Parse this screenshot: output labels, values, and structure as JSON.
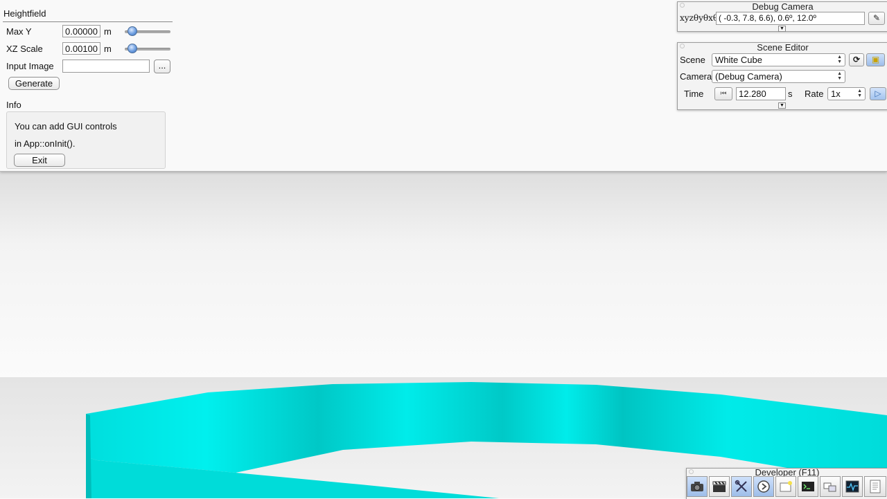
{
  "heightfield": {
    "title": "Heightfield",
    "max_y": {
      "label": "Max Y",
      "value": "0.00000",
      "unit": "m",
      "slider_level": 0.05
    },
    "xz_scale": {
      "label": "XZ Scale",
      "value": "0.00100",
      "unit": "m",
      "slider_level": 0.05
    },
    "input_image": {
      "label": "Input Image",
      "value": "",
      "browse_label": "..."
    },
    "generate_label": "Generate",
    "info": {
      "title": "Info",
      "line1": "You can add GUI controls",
      "line2": "in App::onInit().",
      "exit_label": "Exit"
    }
  },
  "debug_camera": {
    "title": "Debug Camera",
    "coord_label": "xyzθyθxθz",
    "coord_value": "( -0.3,   7.8,   6.6),   0.6º,  12.0º"
  },
  "scene_editor": {
    "title": "Scene Editor",
    "scene_label": "Scene",
    "scene_value": "White Cube",
    "camera_label": "Camera",
    "camera_value": "(Debug Camera)",
    "time_label": "Time",
    "time_value": "12.280",
    "time_unit": "s",
    "rate_label": "Rate",
    "rate_value": "1x"
  },
  "developer": {
    "title": "Developer (F11)",
    "buttons": [
      "camera-icon",
      "clapperboard-icon",
      "tools-icon",
      "speedometer-icon",
      "new-window-icon",
      "terminal-icon",
      "window-manager-icon",
      "profiler-icon",
      "log-icon"
    ]
  },
  "colors": {
    "ring": "#00e3e0",
    "ring_dark": "#00b4b2",
    "panel_bg": "#f9f9f9",
    "slider_knob": "#6d9ee0"
  }
}
